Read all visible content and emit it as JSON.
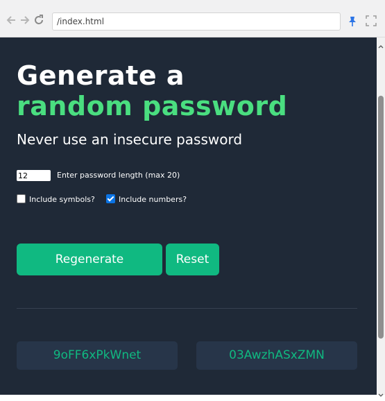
{
  "browser": {
    "url": "/index.html",
    "back_icon": "arrow-left-icon",
    "forward_icon": "arrow-right-icon",
    "reload_icon": "reload-icon",
    "pin_icon": "pin-icon",
    "fullscreen_icon": "fullscreen-icon"
  },
  "page": {
    "title_line1": "Generate a",
    "title_line2": "random password",
    "subtitle": "Never use an insecure password",
    "length_input": {
      "value": "12",
      "label": "Enter password length (max 20)"
    },
    "options": [
      {
        "label": "Include symbols?",
        "checked": false
      },
      {
        "label": "Include numbers?",
        "checked": true
      }
    ],
    "buttons": {
      "regenerate": "Regenerate",
      "reset": "Reset"
    },
    "passwords": [
      "9oFF6xPkWnet",
      "03AwzhASxZMN"
    ]
  },
  "colors": {
    "background": "#1f2937",
    "accent_green": "#4ade80",
    "button": "#10b981",
    "password_box": "#273549"
  }
}
